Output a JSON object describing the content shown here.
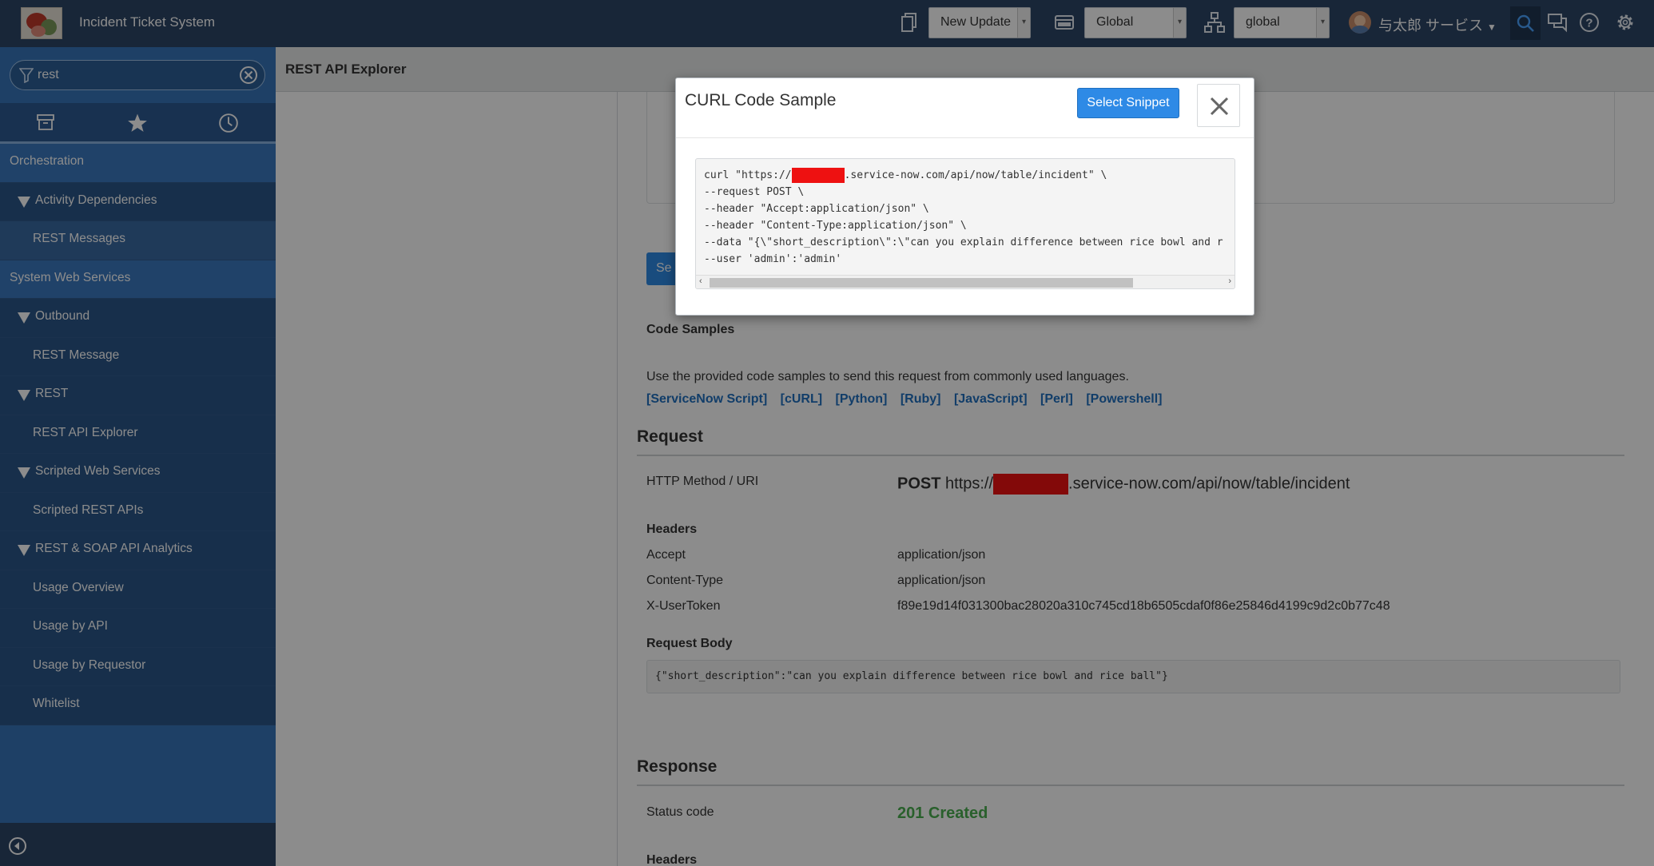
{
  "header": {
    "app_title": "Incident Ticket System",
    "update_set": "New Update",
    "application_scope": "Global",
    "domain": "global",
    "user_name": "与太郎 サービス"
  },
  "sidebar": {
    "filter_value": "rest",
    "items": [
      {
        "label": "Orchestration",
        "kind": "section"
      },
      {
        "label": "Activity Dependencies",
        "kind": "group"
      },
      {
        "label": "REST Messages",
        "kind": "leaf",
        "active": true
      },
      {
        "label": "System Web Services",
        "kind": "section"
      },
      {
        "label": "Outbound",
        "kind": "group"
      },
      {
        "label": "REST Message",
        "kind": "leaf"
      },
      {
        "label": "REST",
        "kind": "group"
      },
      {
        "label": "REST API Explorer",
        "kind": "leaf"
      },
      {
        "label": "Scripted Web Services",
        "kind": "group"
      },
      {
        "label": "Scripted REST APIs",
        "kind": "leaf"
      },
      {
        "label": "REST & SOAP API Analytics",
        "kind": "group"
      },
      {
        "label": "Usage Overview",
        "kind": "leaf"
      },
      {
        "label": "Usage by API",
        "kind": "leaf"
      },
      {
        "label": "Usage by Requestor",
        "kind": "leaf"
      },
      {
        "label": "Whitelist",
        "kind": "leaf"
      }
    ]
  },
  "main": {
    "breadcrumb": "REST API Explorer",
    "code_samples": {
      "title": "Code Samples",
      "description": "Use the provided code samples to send this request from commonly used languages.",
      "links": [
        "[ServiceNow Script]",
        "[cURL]",
        "[Python]",
        "[Ruby]",
        "[JavaScript]",
        "[Perl]",
        "[Powershell]"
      ]
    },
    "request": {
      "title": "Request",
      "method_label": "HTTP Method / URI",
      "method": "POST",
      "uri_prefix": "https://",
      "uri_suffix": ".service-now.com/api/now/table/incident",
      "headers_title": "Headers",
      "headers": [
        {
          "name": "Accept",
          "value": "application/json"
        },
        {
          "name": "Content-Type",
          "value": "application/json"
        },
        {
          "name": "X-UserToken",
          "value": "f89e19d14f031300bac28020a310c745cd18b6505cdaf0f86e25846d4199c9d2c0b77c48"
        }
      ],
      "body_title": "Request Body",
      "body": "{\"short_description\":\"can you explain difference between rice bowl and rice ball\"}"
    },
    "response": {
      "title": "Response",
      "status_label": "Status code",
      "status_value": "201 Created",
      "status_color": "#4caf50",
      "headers_title": "Headers"
    },
    "partial_button": "Se"
  },
  "modal": {
    "title": "CURL Code Sample",
    "select_button": "Select Snippet",
    "code_line1_prefix": "curl \"https://",
    "code_line1_suffix": ".service-now.com/api/now/table/incident\" \\",
    "code_rest": "--request POST \\\n--header \"Accept:application/json\" \\\n--header \"Content-Type:application/json\" \\\n--data \"{\\\"short_description\\\":\\\"can you explain difference between rice bowl and r\n--user 'admin':'admin'"
  },
  "colors": {
    "header_bg": "#2c4566",
    "sidebar_section": "#3b79c0",
    "sidebar_item": "#2b5789",
    "link": "#1f6fbf",
    "primary_button": "#2e8ae6",
    "redaction": "#ee1111"
  },
  "icons": [
    "update-set-icon",
    "scope-icon",
    "domain-icon",
    "search-icon",
    "chat-icon",
    "help-icon",
    "gear-icon",
    "filter-icon",
    "clear-icon",
    "archive-icon",
    "star-icon",
    "history-icon",
    "collapse-icon",
    "close-icon"
  ]
}
